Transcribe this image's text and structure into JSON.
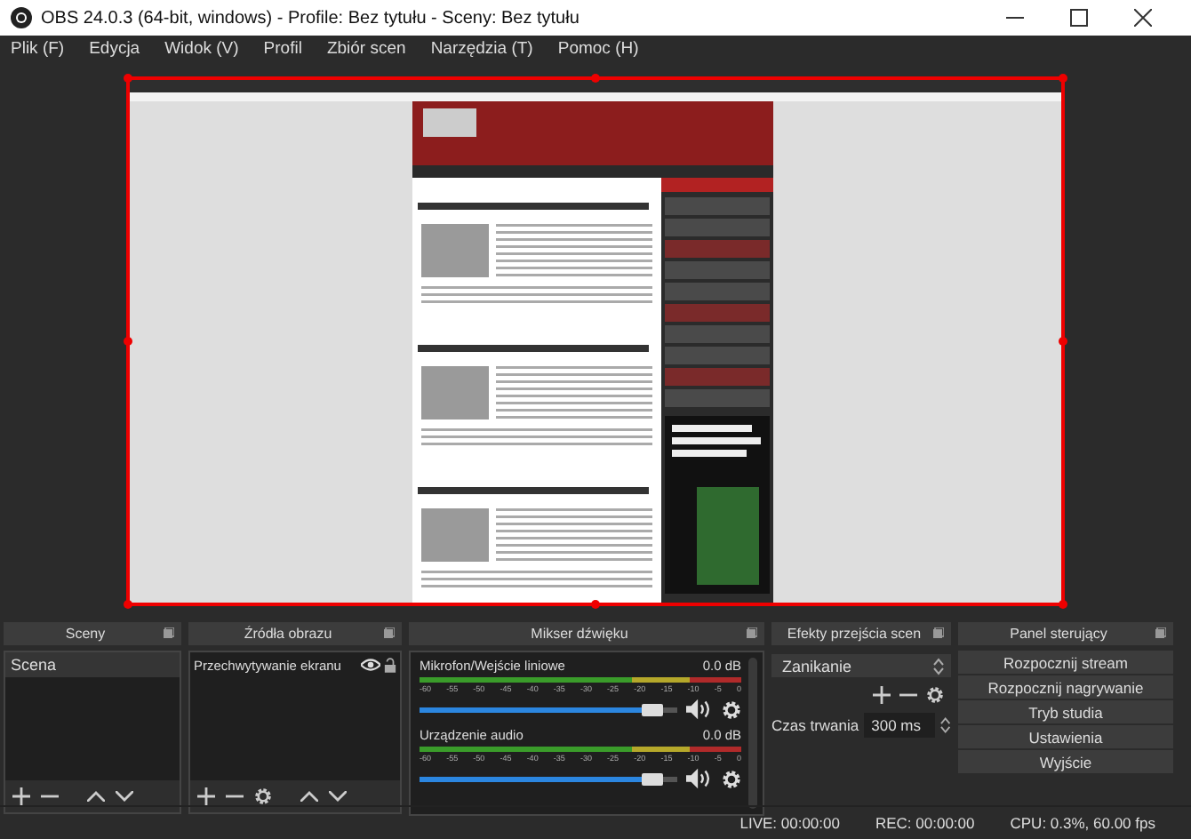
{
  "window": {
    "title": "OBS 24.0.3 (64-bit, windows) - Profile: Bez tytułu - Sceny: Bez tytułu"
  },
  "menu": [
    "Plik (F)",
    "Edycja",
    "Widok (V)",
    "Profil",
    "Zbiór scen",
    "Narzędzia (T)",
    "Pomoc (H)"
  ],
  "scenes": {
    "title": "Sceny",
    "items": [
      {
        "label": "Scena",
        "selected": true
      }
    ]
  },
  "sources": {
    "title": "Źródła obrazu",
    "items": [
      {
        "label": "Przechwytywanie ekranu",
        "visible": true,
        "locked": false
      }
    ]
  },
  "mixer": {
    "title": "Mikser dźwięku",
    "channels": [
      {
        "name": "Mikrofon/Wejście liniowe",
        "reading": "0.0 dB",
        "level": 0.9,
        "muted": false,
        "scale": [
          "-60",
          "-55",
          "-50",
          "-45",
          "-40",
          "-35",
          "-30",
          "-25",
          "-20",
          "-15",
          "-10",
          "-5",
          "0"
        ]
      },
      {
        "name": "Urządzenie audio",
        "reading": "0.0 dB",
        "level": 0.9,
        "muted": false,
        "scale": [
          "-60",
          "-55",
          "-50",
          "-45",
          "-40",
          "-35",
          "-30",
          "-25",
          "-20",
          "-15",
          "-10",
          "-5",
          "0"
        ]
      }
    ]
  },
  "transitions": {
    "title": "Efekty przejścia scen",
    "transition": "Zanikanie",
    "duration_label": "Czas trwania",
    "duration": "300 ms"
  },
  "controls": {
    "title": "Panel sterujący",
    "buttons": [
      "Rozpocznij stream",
      "Rozpocznij nagrywanie",
      "Tryb studia",
      "Ustawienia",
      "Wyjście"
    ]
  },
  "status_bar": [
    "LIVE: 00:00:00",
    "REC: 00:00:00",
    "CPU: 0.3%, 60.00 fps"
  ]
}
